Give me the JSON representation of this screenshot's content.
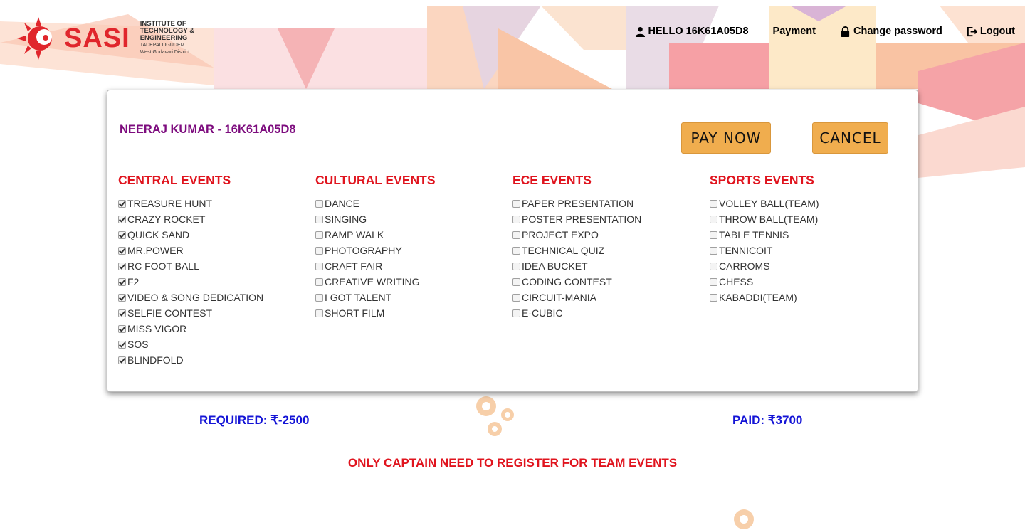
{
  "header": {
    "logo_text": "SASI",
    "logo_subtitle": [
      "INSTITUTE OF",
      "TECHNOLOGY &",
      "ENGINEERING",
      "TADEPALLIGUDEM",
      "West Godavari District"
    ],
    "greeting": "HELLO 16K61A05D8",
    "payment_link": "Payment",
    "change_password_link": "Change password",
    "logout_link": "Logout"
  },
  "student_line": "NEERAJ KUMAR - 16K61A05D8",
  "buttons": {
    "pay_now": "PAY NOW",
    "cancel": "CANCEL"
  },
  "categories": [
    {
      "title": "CENTRAL EVENTS",
      "events": [
        {
          "label": "TREASURE HUNT",
          "checked": true
        },
        {
          "label": "CRAZY ROCKET",
          "checked": true
        },
        {
          "label": "QUICK SAND",
          "checked": true
        },
        {
          "label": "MR.POWER",
          "checked": true
        },
        {
          "label": "RC FOOT BALL",
          "checked": true
        },
        {
          "label": "F2",
          "checked": true
        },
        {
          "label": "VIDEO & SONG DEDICATION",
          "checked": true
        },
        {
          "label": "SELFIE CONTEST",
          "checked": true
        },
        {
          "label": "MISS VIGOR",
          "checked": true
        },
        {
          "label": "SOS",
          "checked": true
        },
        {
          "label": "BLINDFOLD",
          "checked": true
        }
      ]
    },
    {
      "title": "CULTURAL EVENTS",
      "events": [
        {
          "label": "DANCE",
          "checked": false
        },
        {
          "label": "SINGING",
          "checked": false
        },
        {
          "label": "RAMP WALK",
          "checked": false
        },
        {
          "label": "PHOTOGRAPHY",
          "checked": false
        },
        {
          "label": "CRAFT FAIR",
          "checked": false
        },
        {
          "label": "CREATIVE WRITING",
          "checked": false
        },
        {
          "label": "I GOT TALENT",
          "checked": false
        },
        {
          "label": "SHORT FILM",
          "checked": false
        }
      ]
    },
    {
      "title": "ECE EVENTS",
      "events": [
        {
          "label": "PAPER PRESENTATION",
          "checked": false
        },
        {
          "label": "POSTER PRESENTATION",
          "checked": false
        },
        {
          "label": "PROJECT EXPO",
          "checked": false
        },
        {
          "label": "TECHNICAL QUIZ",
          "checked": false
        },
        {
          "label": "IDEA BUCKET",
          "checked": false
        },
        {
          "label": "CODING CONTEST",
          "checked": false
        },
        {
          "label": "CIRCUIT-MANIA",
          "checked": false
        },
        {
          "label": "E-CUBIC",
          "checked": false
        }
      ]
    },
    {
      "title": "SPORTS EVENTS",
      "events": [
        {
          "label": "VOLLEY BALL(TEAM)",
          "checked": false
        },
        {
          "label": "THROW BALL(TEAM)",
          "checked": false
        },
        {
          "label": "TABLE TENNIS",
          "checked": false
        },
        {
          "label": "TENNICOIT",
          "checked": false
        },
        {
          "label": "CARROMS",
          "checked": false
        },
        {
          "label": "CHESS",
          "checked": false
        },
        {
          "label": "KABADDI(TEAM)",
          "checked": false
        }
      ]
    }
  ],
  "required_text": "REQUIRED: ₹-2500",
  "paid_text": "PAID: ₹3700",
  "notice": "ONLY CAPTAIN NEED TO REGISTER FOR TEAM EVENTS",
  "colors": {
    "heading_red": "#e0141e",
    "student_purple": "#7d0c7e",
    "amount_blue": "#1414d6",
    "button_orange": "#f0ad4e"
  }
}
